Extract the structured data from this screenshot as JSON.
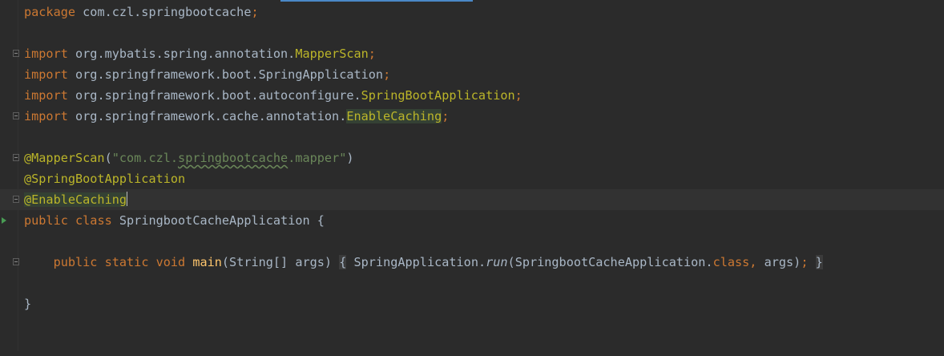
{
  "colors": {
    "background": "#2b2b2b",
    "keyword": "#cc7832",
    "annotation": "#bbb529",
    "string": "#6a8759",
    "method": "#ffc66d",
    "plain": "#a9b7c6"
  },
  "lines": {
    "l1": {
      "kw": "package",
      "rest": " com.czl.springbootcache",
      "semi": ";"
    },
    "l3": {
      "kw": "import",
      "pkg": " org.mybatis.spring.annotation.",
      "cls": "MapperScan",
      "semi": ";"
    },
    "l4": {
      "kw": "import",
      "pkg": " org.springframework.boot.SpringApplication",
      "semi": ";"
    },
    "l5": {
      "kw": "import",
      "pkg": " org.springframework.boot.autoconfigure.",
      "cls": "SpringBootApplication",
      "semi": ";"
    },
    "l6": {
      "kw": "import",
      "pkg": " org.springframework.cache.annotation.",
      "cls": "EnableCaching",
      "semi": ";"
    },
    "l8": {
      "ann": "@MapperScan",
      "open": "(",
      "str_a": "\"com.czl.",
      "str_b": "springbootcache",
      "str_c": ".mapper\"",
      "close": ")"
    },
    "l9": {
      "ann": "@SpringBootApplication"
    },
    "l10": {
      "ann": "@EnableCaching"
    },
    "l11": {
      "kw1": "public",
      "kw2": " class",
      "name": " SpringbootCacheApplication {"
    },
    "l13": {
      "kw1": "public",
      "kw2": " static",
      "kw3": " void",
      "fn": " main",
      "sig": "(String[] args)",
      "brace_open": "{",
      "call_a": " SpringApplication.",
      "call_run": "run",
      "call_b": "(SpringbootCacheApplication.",
      "call_kw": "class,",
      "call_c": " args)",
      "semi": ";",
      "brace_close": "}"
    },
    "l15": {
      "text": "}"
    }
  }
}
